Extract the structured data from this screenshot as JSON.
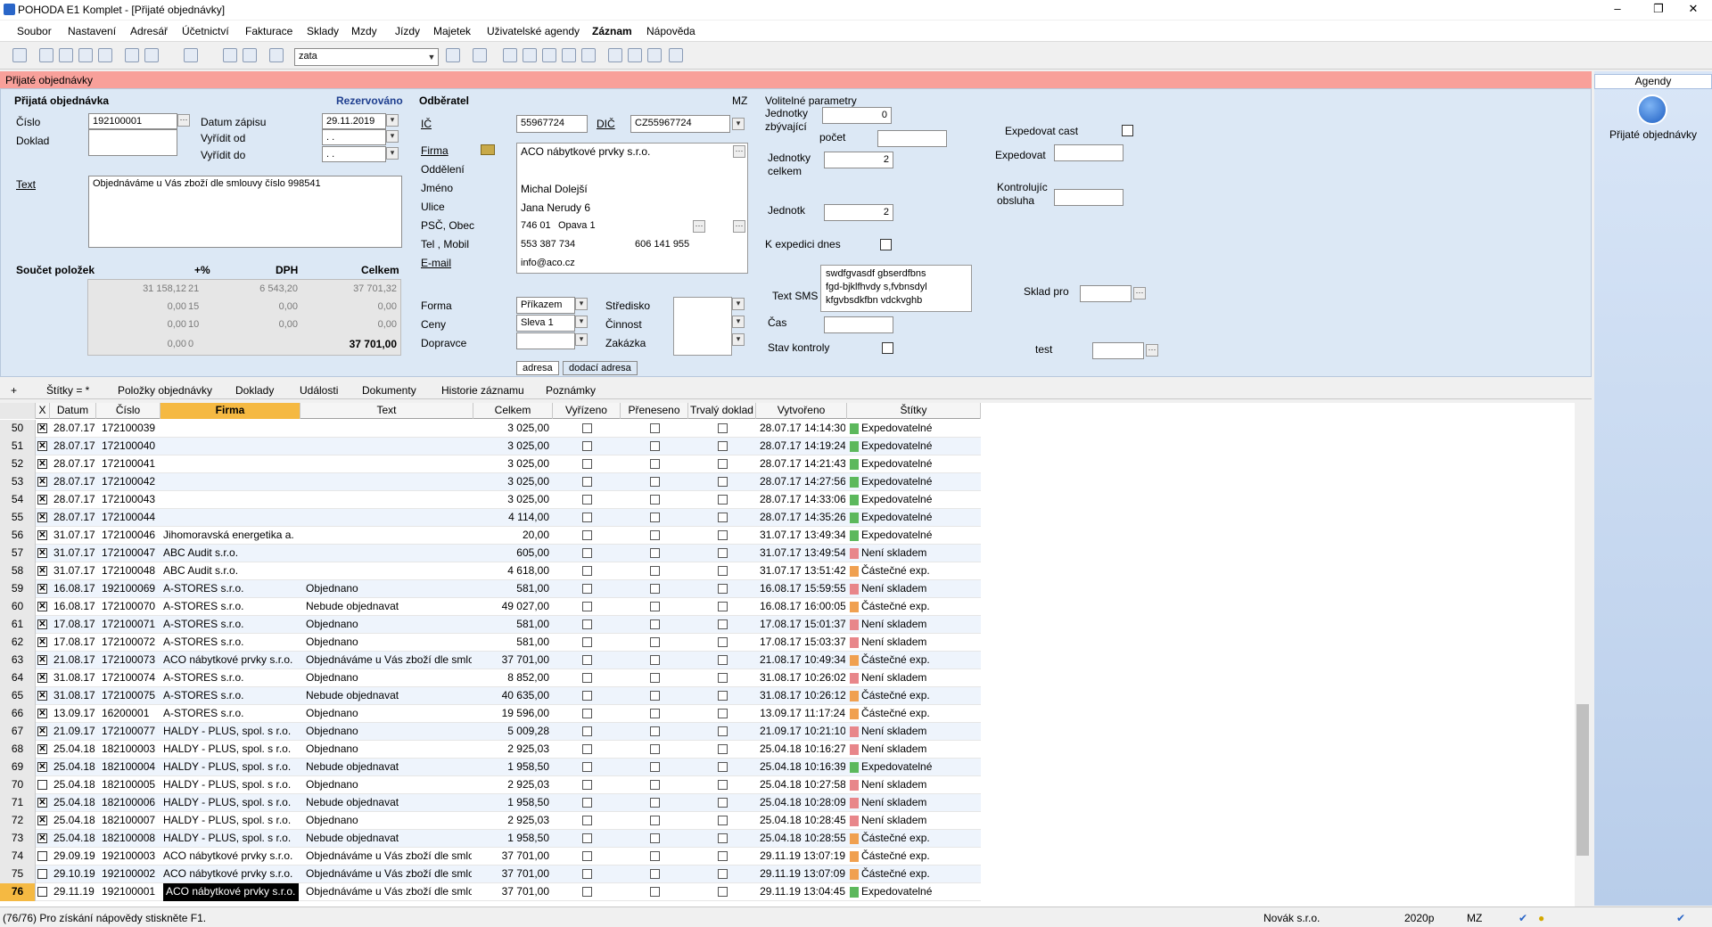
{
  "app": {
    "title": "POHODA E1 Komplet - [Přijaté objednávky]",
    "minimize": "–",
    "maximize": "❐",
    "close": "✕"
  },
  "menu": [
    "Soubor",
    "Nastavení",
    "Adresář",
    "Účetnictví",
    "Fakturace",
    "Sklady",
    "Mzdy",
    "Jízdy",
    "Majetek",
    "Uživatelské agendy",
    "Záznam",
    "Nápověda"
  ],
  "toolbar": {
    "combo_value": "zata"
  },
  "form": {
    "header": "Přijaté objednávky",
    "section": "Přijatá objednávka",
    "status": "Rezervováno",
    "cislo_label": "Číslo",
    "cislo": "192100001",
    "doklad_label": "Doklad",
    "datum_zapisu_label": "Datum zápisu",
    "datum_zapisu": "29.11.2019",
    "vyridit_od_label": "Vyřídit od",
    "vyridit_od": ". .",
    "vyridit_do_label": "Vyřídit do",
    "vyridit_do": ". .",
    "text_label": "Text",
    "text": "Objednáváme u Vás zboží dle smlouvy číslo 998541",
    "sum": {
      "title": "Součet položek",
      "h_pct": "+%",
      "h_dph": "DPH",
      "h_celkem": "Celkem",
      "rows": [
        [
          "31 158,12",
          "21",
          "6 543,20",
          "37 701,32"
        ],
        [
          "0,00",
          "15",
          "0,00",
          "0,00"
        ],
        [
          "0,00",
          "10",
          "0,00",
          "0,00"
        ],
        [
          "0,00",
          "0",
          "",
          "37 701,00"
        ]
      ]
    },
    "odberatel_label": "Odběratel",
    "mz": "MZ",
    "ic_label": "IČ",
    "ic": "55967724",
    "dic_label": "DIČ",
    "dic": "CZ55967724",
    "firma_label": "Firma",
    "firma": "ACO nábytkové prvky s.r.o.",
    "oddeleni_label": "Oddělení",
    "jmeno_label": "Jméno",
    "jmeno": "Michal Dolejší",
    "ulice_label": "Ulice",
    "ulice": "Jana Nerudy 6",
    "psc_label": "PSČ, Obec",
    "psc": "746 01",
    "obec": "Opava 1",
    "tel_label": "Tel , Mobil",
    "tel": "553 387 734",
    "mobil": "606 141 955",
    "email_label": "E-mail",
    "email": "info@aco.cz",
    "tab_adresa": "adresa",
    "tab_dodaci": "dodací adresa",
    "forma_label": "Forma",
    "forma": "Příkazem",
    "ceny_label": "Ceny",
    "ceny": "Sleva 1",
    "dopravce_label": "Dopravce",
    "stredisko_label": "Středisko",
    "cinnost_label": "Činnost",
    "zakazka_label": "Zakázka",
    "volitelne": "Volitelné parametry",
    "jz_label1": "Jednotky",
    "jz_label2": "zbývající",
    "jz": "0",
    "pocet_label": "počet",
    "jc_label1": "Jednotky",
    "jc_label2": "celkem",
    "jc": "2",
    "jednotk_label": "Jednotk",
    "jednotk": "2",
    "kexp_label": "K expedici dnes",
    "sms_label": "Text SMS",
    "sms": [
      "swdfgvasdf gbserdfbns",
      "fgd-bjklfhvdy s,fvbnsdyl",
      "kfgvbsdkfbn vdckvghb"
    ],
    "cas_label": "Čas",
    "stav_label": "Stav kontroly",
    "expcast_label": "Expedovat cast",
    "expedovat_label": "Expedovat",
    "kontr_label1": "Kontrolujíc",
    "kontr_label2": "obsluha",
    "sklad_label": "Sklad pro",
    "test_label": "test"
  },
  "agenda": {
    "title": "Agendy",
    "item": "Přijaté objednávky"
  },
  "tabs": [
    "Štítky = *",
    "Položky objednávky",
    "Doklady",
    "Události",
    "Dokumenty",
    "Historie záznamu",
    "Poznámky"
  ],
  "grid": {
    "columns": [
      "X",
      "Datum",
      "Číslo",
      "Firma",
      "Text",
      "Celkem",
      "Vyřízeno",
      "Přeneseno",
      "Trvalý doklad",
      "Vytvořeno",
      "Štítky"
    ],
    "rows": [
      [
        "50",
        true,
        "28.07.17",
        "172100039",
        "",
        "",
        "3 025,00",
        "28.07.17 14:14:30",
        "Expedovatelné",
        "g"
      ],
      [
        "51",
        true,
        "28.07.17",
        "172100040",
        "",
        "",
        "3 025,00",
        "28.07.17 14:19:24",
        "Expedovatelné",
        "g"
      ],
      [
        "52",
        true,
        "28.07.17",
        "172100041",
        "",
        "",
        "3 025,00",
        "28.07.17 14:21:43",
        "Expedovatelné",
        "g"
      ],
      [
        "53",
        true,
        "28.07.17",
        "172100042",
        "",
        "",
        "3 025,00",
        "28.07.17 14:27:56",
        "Expedovatelné",
        "g"
      ],
      [
        "54",
        true,
        "28.07.17",
        "172100043",
        "",
        "",
        "3 025,00",
        "28.07.17 14:33:06",
        "Expedovatelné",
        "g"
      ],
      [
        "55",
        true,
        "28.07.17",
        "172100044",
        "",
        "",
        "4 114,00",
        "28.07.17 14:35:26",
        "Expedovatelné",
        "g"
      ],
      [
        "56",
        true,
        "31.07.17",
        "172100046",
        "Jihomoravská energetika a.",
        "",
        "20,00",
        "31.07.17 13:49:34",
        "Expedovatelné",
        "g"
      ],
      [
        "57",
        true,
        "31.07.17",
        "172100047",
        "ABC Audit s.r.o.",
        "",
        "605,00",
        "31.07.17 13:49:54",
        "Není skladem",
        "r"
      ],
      [
        "58",
        true,
        "31.07.17",
        "172100048",
        "ABC Audit s.r.o.",
        "",
        "4 618,00",
        "31.07.17 13:51:42",
        "Částečné exp.",
        "o"
      ],
      [
        "59",
        true,
        "16.08.17",
        "192100069",
        "A-STORES s.r.o.",
        "Objednano",
        "581,00",
        "16.08.17 15:59:55",
        "Není skladem",
        "r"
      ],
      [
        "60",
        true,
        "16.08.17",
        "172100070",
        "A-STORES s.r.o.",
        "Nebude objednavat",
        "49 027,00",
        "16.08.17 16:00:05",
        "Částečné exp.",
        "o"
      ],
      [
        "61",
        true,
        "17.08.17",
        "172100071",
        "A-STORES s.r.o.",
        "Objednano",
        "581,00",
        "17.08.17 15:01:37",
        "Není skladem",
        "r"
      ],
      [
        "62",
        true,
        "17.08.17",
        "172100072",
        "A-STORES s.r.o.",
        "Objednano",
        "581,00",
        "17.08.17 15:03:37",
        "Není skladem",
        "r"
      ],
      [
        "63",
        true,
        "21.08.17",
        "172100073",
        "ACO nábytkové prvky s.r.o.",
        "Objednáváme u Vás zboží dle smlo",
        "37 701,00",
        "21.08.17 10:49:34",
        "Částečné exp.",
        "o"
      ],
      [
        "64",
        true,
        "31.08.17",
        "172100074",
        "A-STORES s.r.o.",
        "Objednano",
        "8 852,00",
        "31.08.17 10:26:02",
        "Není skladem",
        "r"
      ],
      [
        "65",
        true,
        "31.08.17",
        "172100075",
        "A-STORES s.r.o.",
        "Nebude objednavat",
        "40 635,00",
        "31.08.17 10:26:12",
        "Částečné exp.",
        "o"
      ],
      [
        "66",
        true,
        "13.09.17",
        "16200001",
        "A-STORES s.r.o.",
        "Objednano",
        "19 596,00",
        "13.09.17 11:17:24",
        "Částečné exp.",
        "o"
      ],
      [
        "67",
        true,
        "21.09.17",
        "172100077",
        "HALDY - PLUS, spol. s r.o.",
        "Objednano",
        "5 009,28",
        "21.09.17 10:21:10",
        "Není skladem",
        "r"
      ],
      [
        "68",
        true,
        "25.04.18",
        "182100003",
        "HALDY - PLUS, spol. s r.o.",
        "Objednano",
        "2 925,03",
        "25.04.18 10:16:27",
        "Není skladem",
        "r"
      ],
      [
        "69",
        true,
        "25.04.18",
        "182100004",
        "HALDY - PLUS, spol. s r.o.",
        "Nebude objednavat",
        "1 958,50",
        "25.04.18 10:16:39",
        "Expedovatelné",
        "g"
      ],
      [
        "70",
        false,
        "25.04.18",
        "182100005",
        "HALDY - PLUS, spol. s r.o.",
        "Objednano",
        "2 925,03",
        "25.04.18 10:27:58",
        "Není skladem",
        "r"
      ],
      [
        "71",
        true,
        "25.04.18",
        "182100006",
        "HALDY - PLUS, spol. s r.o.",
        "Nebude objednavat",
        "1 958,50",
        "25.04.18 10:28:09",
        "Není skladem",
        "r"
      ],
      [
        "72",
        true,
        "25.04.18",
        "182100007",
        "HALDY - PLUS, spol. s r.o.",
        "Objednano",
        "2 925,03",
        "25.04.18 10:28:45",
        "Není skladem",
        "r"
      ],
      [
        "73",
        true,
        "25.04.18",
        "182100008",
        "HALDY - PLUS, spol. s r.o.",
        "Nebude objednavat",
        "1 958,50",
        "25.04.18 10:28:55",
        "Částečné exp.",
        "o"
      ],
      [
        "74",
        false,
        "29.09.19",
        "192100003",
        "ACO nábytkové prvky s.r.o.",
        "Objednáváme u Vás zboží dle smlo",
        "37 701,00",
        "29.11.19 13:07:19",
        "Částečné exp.",
        "o"
      ],
      [
        "75",
        false,
        "29.10.19",
        "192100002",
        "ACO nábytkové prvky s.r.o.",
        "Objednáváme u Vás zboží dle smlo",
        "37 701,00",
        "29.11.19 13:07:09",
        "Částečné exp.",
        "o"
      ],
      [
        "76",
        false,
        "29.11.19",
        "192100001",
        "ACO nábytkové prvky s.r.o.",
        "Objednáváme u Vás zboží dle smlo",
        "37 701,00",
        "29.11.19 13:04:45",
        "Expedovatelné",
        "g"
      ]
    ],
    "tag_colors": {
      "g": "#5cb85c",
      "r": "#e8868a",
      "o": "#f0a050"
    }
  },
  "status": {
    "text": "(76/76) Pro získání nápovědy stiskněte F1.",
    "user": "Novák s.r.o.",
    "year": "2020p",
    "mz": "MZ"
  }
}
